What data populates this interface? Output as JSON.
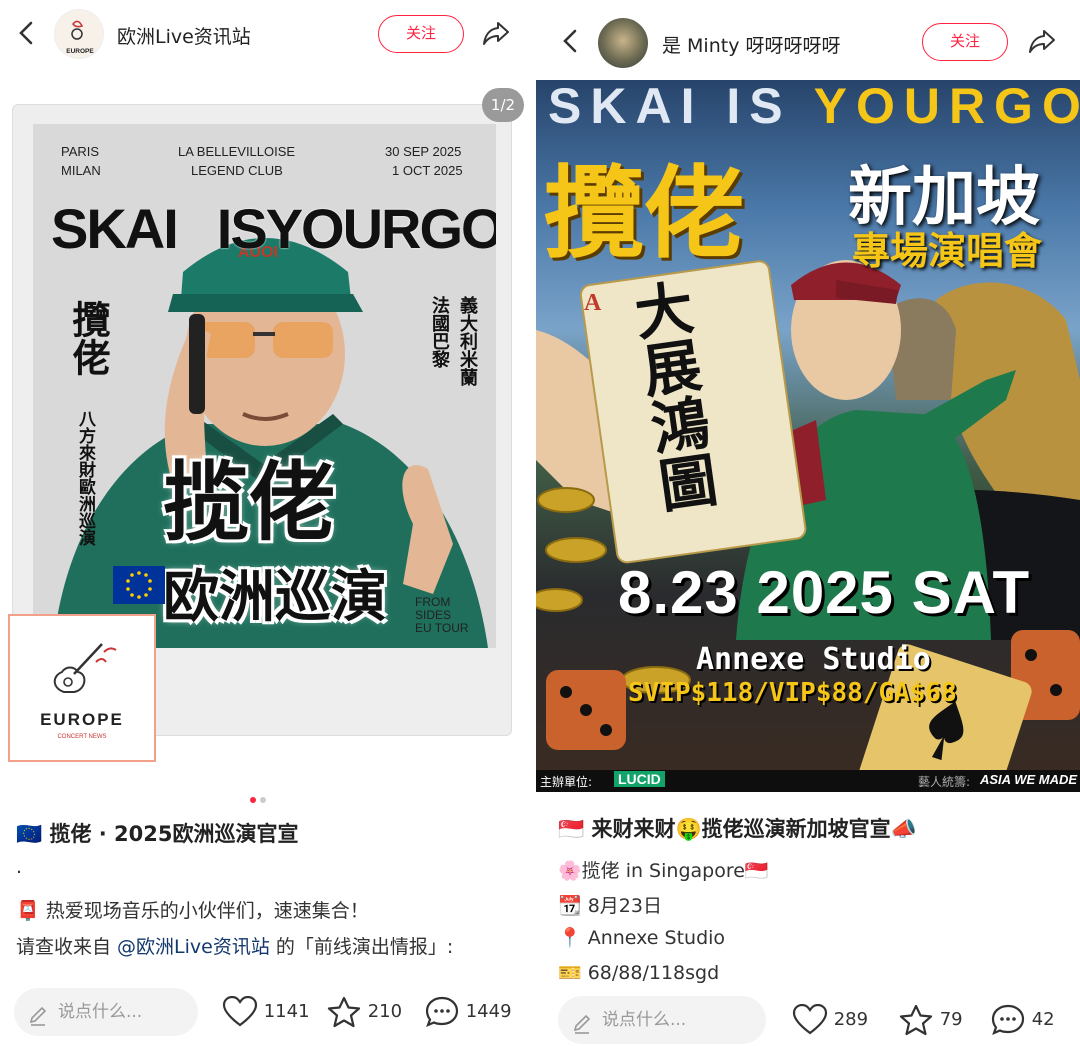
{
  "left": {
    "header": {
      "back_icon": "chevron-left-icon",
      "username": "欧洲Live资讯站",
      "follow_label": "关注",
      "share_icon": "share-icon",
      "logo_text": "EUROPE"
    },
    "pager": "1/2",
    "poster": {
      "city1": "PARIS",
      "city2": "MILAN",
      "venue1": "LA BELLEVILLOISE",
      "venue2": "LEGEND CLUB",
      "date1": "30 SEP 2025",
      "date2": "1 OCT 2025",
      "headline_a": "SKAI",
      "headline_b": "ISYOUR",
      "headline_c": "GOD",
      "cap_brand": "AUOI",
      "vertical_name": "攬佬",
      "vertical_sub": "八方來財歐洲巡演",
      "vertical_city_a": "法國巴黎",
      "vertical_city_b": "義大利米蘭",
      "big_title": "揽佬",
      "big_subtitle": "欧洲巡演",
      "tour_note": "FROM\nSIDES\nEU TOUR"
    },
    "europe_logo": {
      "name": "EUROPE",
      "sub": "CONCERT NEWS"
    },
    "caption": {
      "title": "🇪🇺 揽佬 · 2025欧洲巡演官宣",
      "dot": ".",
      "line1": "📮 热爱现场音乐的小伙伴们，速速集合！",
      "line2_pre": "请查收来自 ",
      "line2_mention": "@欧洲Live资讯站",
      "line2_post": " 的「前线演出情报」:"
    },
    "bottom": {
      "placeholder": "说点什么...",
      "likes": "1141",
      "stars": "210",
      "comments": "1449"
    }
  },
  "right": {
    "header": {
      "back_icon": "chevron-left-icon",
      "username": "是 Minty 呀呀呀呀呀",
      "follow_label": "关注",
      "share_icon": "share-icon"
    },
    "poster": {
      "headline_a": "SKAI IS ",
      "headline_b": "YOURGOD",
      "name": "攬佬",
      "city": "新加坡",
      "show": "專場演唱會",
      "card_text": "大展鴻圖",
      "card_rank": "A",
      "date": "8.23 2025 SAT",
      "venue": "Annexe Studio",
      "prices": "SVIP$118/VIP$88/GA$68",
      "organizer_label": "主辦單位:",
      "organizer": "LUCID",
      "footer_right": "ASIA WE MADE",
      "footer_mid": "藝人統籌:"
    },
    "caption": {
      "title": "🇸🇬 来财来财🤑揽佬巡演新加坡官宣📣",
      "line1": "🌸揽佬 in Singapore🇸🇬",
      "line2": "📆 8月23日",
      "line3": "📍 Annexe Studio",
      "line4": "🎫 68/88/118sgd"
    },
    "bottom": {
      "placeholder": "说点什么...",
      "likes": "289",
      "stars": "79",
      "comments": "42"
    }
  },
  "colors": {
    "accent": "#ff2442",
    "mention": "#13386c",
    "gold": "#f5c518"
  }
}
